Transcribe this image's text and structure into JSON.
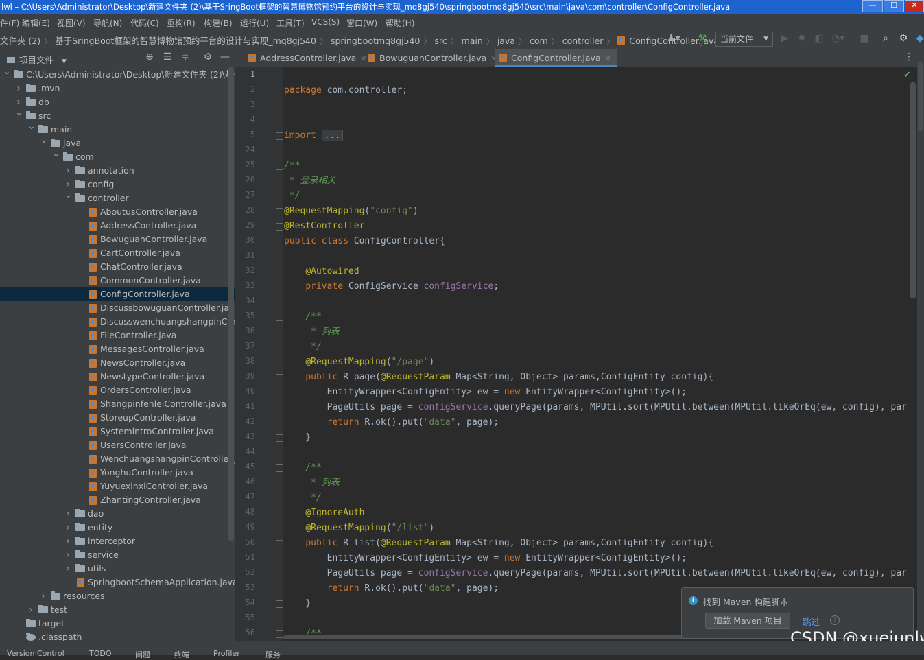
{
  "titlebar": {
    "text": "lwl – C:\\Users\\Administrator\\Desktop\\新建文件夹 (2)\\基于SringBoot框架的智慧博物馆预约平台的设计与实现_mq8gj540\\springbootmq8gj540\\src\\main\\java\\com\\controller\\ConfigController.java",
    "min": "—",
    "max": "☐",
    "close": "✕"
  },
  "menu": [
    "件(F)",
    "编辑(E)",
    "视图(V)",
    "导航(N)",
    "代码(C)",
    "重构(R)",
    "构建(B)",
    "运行(U)",
    "工具(T)",
    "VCS(S)",
    "窗口(W)",
    "帮助(H)"
  ],
  "breadcrumb": [
    "文件夹 (2)",
    "基于SringBoot框架的智慧博物馆预约平台的设计与实现_mq8gj540",
    "springbootmq8gj540",
    "src",
    "main",
    "java",
    "com",
    "controller",
    "ConfigController.java"
  ],
  "run_config": "当前文件",
  "project_panel": {
    "title": "项目文件"
  },
  "tree": [
    {
      "label": "C:\\Users\\Administrator\\Desktop\\新建文件夹 (2)\\基于S",
      "type": "folder",
      "level": 0,
      "open": true
    },
    {
      "label": ".mvn",
      "type": "folder",
      "level": 1,
      "open": false
    },
    {
      "label": "db",
      "type": "folder",
      "level": 1,
      "open": false
    },
    {
      "label": "src",
      "type": "folder",
      "level": 1,
      "open": true
    },
    {
      "label": "main",
      "type": "folder",
      "level": 2,
      "open": true
    },
    {
      "label": "java",
      "type": "folder",
      "level": 3,
      "open": true
    },
    {
      "label": "com",
      "type": "folder",
      "level": 4,
      "open": true
    },
    {
      "label": "annotation",
      "type": "folder",
      "level": 5,
      "open": false
    },
    {
      "label": "config",
      "type": "folder",
      "level": 5,
      "open": false
    },
    {
      "label": "controller",
      "type": "folder",
      "level": 5,
      "open": true
    },
    {
      "label": "AboutusController.java",
      "type": "java",
      "level": 6
    },
    {
      "label": "AddressController.java",
      "type": "java",
      "level": 6
    },
    {
      "label": "BowuguanController.java",
      "type": "java",
      "level": 6
    },
    {
      "label": "CartController.java",
      "type": "java",
      "level": 6
    },
    {
      "label": "ChatController.java",
      "type": "java",
      "level": 6
    },
    {
      "label": "CommonController.java",
      "type": "java",
      "level": 6
    },
    {
      "label": "ConfigController.java",
      "type": "java",
      "level": 6,
      "selected": true
    },
    {
      "label": "DiscussbowuguanController.java",
      "type": "java",
      "level": 6
    },
    {
      "label": "DiscusswenchuangshangpinContro",
      "type": "java",
      "level": 6
    },
    {
      "label": "FileController.java",
      "type": "java",
      "level": 6
    },
    {
      "label": "MessagesController.java",
      "type": "java",
      "level": 6
    },
    {
      "label": "NewsController.java",
      "type": "java",
      "level": 6
    },
    {
      "label": "NewstypeController.java",
      "type": "java",
      "level": 6
    },
    {
      "label": "OrdersController.java",
      "type": "java",
      "level": 6
    },
    {
      "label": "ShangpinfenleiController.java",
      "type": "java",
      "level": 6
    },
    {
      "label": "StoreupController.java",
      "type": "java",
      "level": 6
    },
    {
      "label": "SystemintroController.java",
      "type": "java",
      "level": 6
    },
    {
      "label": "UsersController.java",
      "type": "java",
      "level": 6
    },
    {
      "label": "WenchuangshangpinController.jav",
      "type": "java",
      "level": 6
    },
    {
      "label": "YonghuController.java",
      "type": "java",
      "level": 6
    },
    {
      "label": "YuyuexinxiController.java",
      "type": "java",
      "level": 6
    },
    {
      "label": "ZhantingController.java",
      "type": "java",
      "level": 6
    },
    {
      "label": "dao",
      "type": "folder",
      "level": 5,
      "open": false
    },
    {
      "label": "entity",
      "type": "folder",
      "level": 5,
      "open": false
    },
    {
      "label": "interceptor",
      "type": "folder",
      "level": 5,
      "open": false
    },
    {
      "label": "service",
      "type": "folder",
      "level": 5,
      "open": false
    },
    {
      "label": "utils",
      "type": "folder",
      "level": 5,
      "open": false
    },
    {
      "label": "SpringbootSchemaApplication.java",
      "type": "java",
      "level": 5
    },
    {
      "label": "resources",
      "type": "folder",
      "level": 3,
      "open": false
    },
    {
      "label": "test",
      "type": "folder",
      "level": 2,
      "open": false
    },
    {
      "label": "target",
      "type": "folder",
      "level": 1,
      "noarrow": true
    },
    {
      "label": ".classpath",
      "type": "file",
      "level": 1
    }
  ],
  "tabs": [
    {
      "label": "AddressController.java",
      "active": false
    },
    {
      "label": "BowuguanController.java",
      "active": false
    },
    {
      "label": "ConfigController.java",
      "active": true
    }
  ],
  "code_lines": [
    {
      "n": "1",
      "html": ""
    },
    {
      "n": "2",
      "html": "<span class='kw'>package</span> com.controller;"
    },
    {
      "n": "3",
      "html": ""
    },
    {
      "n": "4",
      "html": ""
    },
    {
      "n": "5",
      "html": "<span class='kw'>import</span> <span class='fold-dots'>...</span>",
      "fold": true
    },
    {
      "n": "24",
      "html": ""
    },
    {
      "n": "25",
      "html": "<span class='cm'>/**</span>",
      "fold": true
    },
    {
      "n": "26",
      "html": "<span class='cm'> * 登录相关</span>"
    },
    {
      "n": "27",
      "html": "<span class='cm'> */</span>"
    },
    {
      "n": "28",
      "html": "<span class='an'>@RequestMapping</span>(<span class='st'>\"config\"</span>)",
      "fold": true
    },
    {
      "n": "29",
      "html": "<span class='an'>@RestController</span>",
      "fold": true
    },
    {
      "n": "30",
      "html": "<span class='kw'>public class</span> ConfigController{"
    },
    {
      "n": "31",
      "html": ""
    },
    {
      "n": "32",
      "html": "    <span class='an'>@Autowired</span>"
    },
    {
      "n": "33",
      "html": "    <span class='kw'>private</span> ConfigService <span class='fd'>configService</span>;"
    },
    {
      "n": "34",
      "html": ""
    },
    {
      "n": "35",
      "html": "    <span class='cm'>/**</span>",
      "fold": true
    },
    {
      "n": "36",
      "html": "<span class='cm'>     * 列表</span>"
    },
    {
      "n": "37",
      "html": "<span class='cm'>     */</span>"
    },
    {
      "n": "38",
      "html": "    <span class='an'>@RequestMapping</span>(<span class='st'>\"/page\"</span>)"
    },
    {
      "n": "39",
      "html": "    <span class='kw'>public</span> R page(<span class='an'>@RequestParam</span> Map&lt;String, Object&gt; params,ConfigEntity config){",
      "fold": true
    },
    {
      "n": "40",
      "html": "        EntityWrapper&lt;ConfigEntity&gt; ew = <span class='kw'>new</span> EntityWrapper&lt;ConfigEntity&gt;();"
    },
    {
      "n": "41",
      "html": "        PageUtils page = <span class='fd'>configService</span>.queryPage(params, MPUtil.sort(MPUtil.between(MPUtil.likeOrEq(ew, config), par"
    },
    {
      "n": "42",
      "html": "        <span class='kw'>return</span> R.ok().put(<span class='st'>\"data\"</span>, page);"
    },
    {
      "n": "43",
      "html": "    }",
      "fold": true
    },
    {
      "n": "44",
      "html": ""
    },
    {
      "n": "45",
      "html": "    <span class='cm'>/**</span>",
      "fold": true
    },
    {
      "n": "46",
      "html": "<span class='cm'>     * 列表</span>"
    },
    {
      "n": "47",
      "html": "<span class='cm'>     */</span>"
    },
    {
      "n": "48",
      "html": "    <span class='an'>@IgnoreAuth</span>"
    },
    {
      "n": "49",
      "html": "    <span class='an'>@RequestMapping</span>(<span class='st'>\"/list\"</span>)"
    },
    {
      "n": "50",
      "html": "    <span class='kw'>public</span> R list(<span class='an'>@RequestParam</span> Map&lt;String, Object&gt; params,ConfigEntity config){",
      "fold": true
    },
    {
      "n": "51",
      "html": "        EntityWrapper&lt;ConfigEntity&gt; ew = <span class='kw'>new</span> EntityWrapper&lt;ConfigEntity&gt;();"
    },
    {
      "n": "52",
      "html": "        PageUtils page = <span class='fd'>configService</span>.queryPage(params, MPUtil.sort(MPUtil.between(MPUtil.likeOrEq(ew, config), par"
    },
    {
      "n": "53",
      "html": "        <span class='kw'>return</span> R.ok().put(<span class='st'>\"data\"</span>, page);"
    },
    {
      "n": "54",
      "html": "    }",
      "fold": true
    },
    {
      "n": "55",
      "html": ""
    },
    {
      "n": "56",
      "html": "    <span class='cm'>/**</span>",
      "fold": true
    }
  ],
  "notification": {
    "message": "找到 Maven 构建脚本",
    "load_button": "加载 Maven 项目",
    "skip_link": "跳过"
  },
  "watermark": "CSDN @xuejunlw",
  "status_tabs": [
    "Version Control",
    "TODO",
    "问题",
    "终端",
    "Profiler",
    "服务"
  ],
  "colors": {
    "titlebar": "#1c63cf",
    "keyword": "#cc7832",
    "annotation": "#bbb529",
    "string": "#6a8759",
    "comment": "#629755",
    "selection": "#0d293e"
  }
}
